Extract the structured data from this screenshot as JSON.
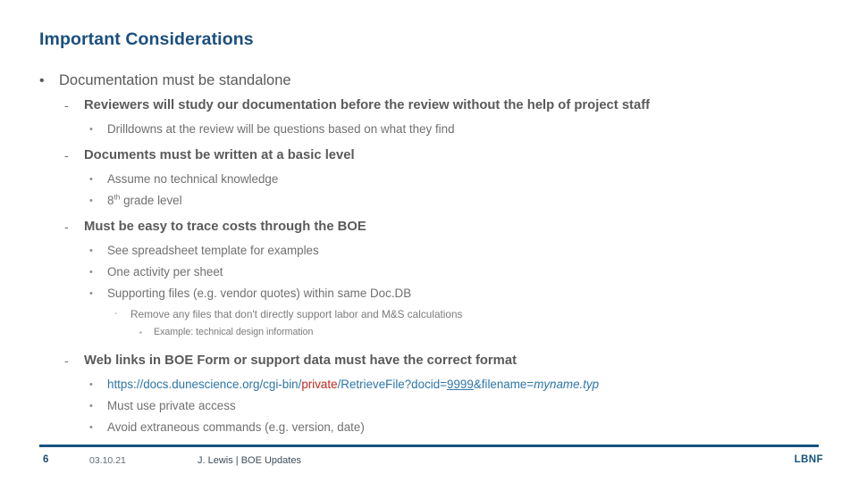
{
  "slide": {
    "title": "Important Considerations",
    "title_color": "#1b4f7c",
    "background": "#ffffff"
  },
  "outline": {
    "l1_documentation": "Documentation must be standalone",
    "l2_reviewers": "Reviewers will study our documentation before the review without the help of project staff",
    "l3_drilldowns": "Drilldowns at the review will be questions based on what they find",
    "l2_basic_level": "Documents must be written at a basic level",
    "l3_no_technical": "Assume no technical knowledge",
    "l3_grade_level_num": "8",
    "l3_grade_level_ord": "th",
    "l3_grade_level_rest": " grade level",
    "l2_trace_costs": "Must be easy to trace costs through the BOE",
    "l3_spreadsheet": "See spreadsheet template for examples",
    "l3_one_activity": "One activity per sheet",
    "l3_supporting": "Supporting files (e.g. vendor quotes) within same Doc.DB",
    "l4_remove_files": "Remove any files that don't directly support labor and M&S calculations",
    "l5_example": "Example: technical design information",
    "l2_web_links": "Web links in BOE Form or support data must have the correct format",
    "l3_must_private": "Must use private access",
    "l3_avoid_extraneous": "Avoid extraneous commands (e.g. version, date)"
  },
  "url_example": {
    "part_base": "https://docs.dunescience.org/cgi-bin/",
    "part_private": "private",
    "part_slash": "/",
    "part_path": "RetrieveFile?docid=",
    "part_docid": "9999",
    "part_query": "&filename=",
    "part_filename": "myname.typ",
    "color_base": "#2f75a8",
    "color_private": "#c0281f"
  },
  "markers": {
    "bullet_round": "•",
    "dash": "-",
    "small_dash": "-",
    "square": "▪"
  },
  "footer": {
    "page_number": "6",
    "date": "03.10.21",
    "credit": "J. Lewis | BOE Updates",
    "brand": "LBNF",
    "rule_color": "#14527d"
  }
}
